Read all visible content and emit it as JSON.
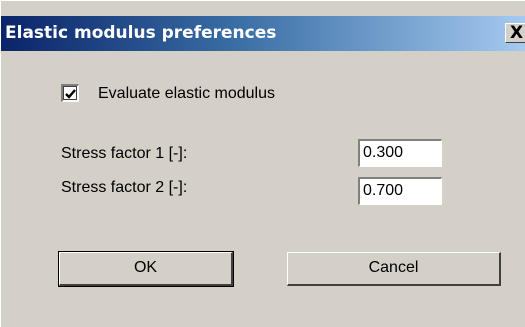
{
  "dialog": {
    "title": "Elastic modulus preferences",
    "close_label": "X"
  },
  "options": {
    "evaluate_label": "Evaluate elastic modulus",
    "evaluate_checked": true
  },
  "fields": {
    "stress_factor_1": {
      "label": "Stress factor 1 [-]:",
      "value": "0.300"
    },
    "stress_factor_2": {
      "label": "Stress factor 2 [-]:",
      "value": "0.700"
    }
  },
  "buttons": {
    "ok_label": "OK",
    "cancel_label": "Cancel"
  },
  "colors": {
    "title_start": "#0a246a",
    "title_end": "#a6caf0",
    "face": "#d4d0c8"
  },
  "icons": {
    "close": "close-icon",
    "check": "checkmark-icon"
  }
}
